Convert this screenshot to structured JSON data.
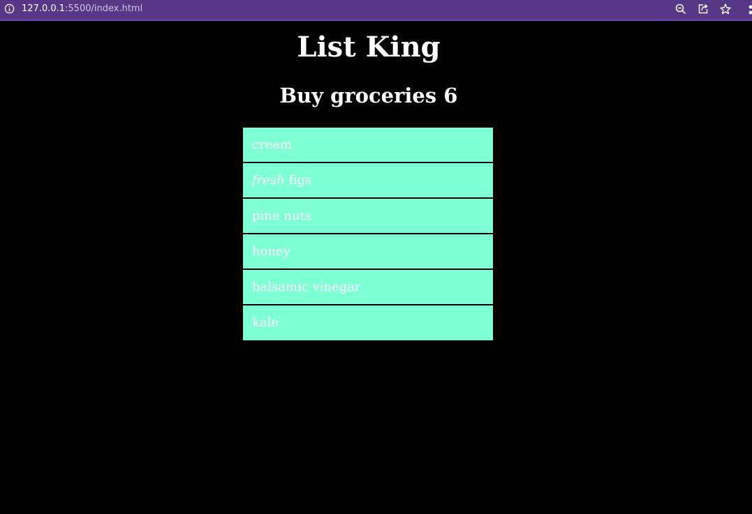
{
  "browser": {
    "url_host": "127.0.0.1",
    "url_rest": ":5500/index.html",
    "icons": [
      "site-info-icon",
      "zoom-out-icon",
      "share-icon",
      "star-icon",
      "extensions-menu-icon"
    ]
  },
  "page": {
    "site_title": "List King",
    "list_title": "Buy groceries 6",
    "items": [
      {
        "label": "cream"
      },
      {
        "emphasis": "fresh",
        "label": " figs"
      },
      {
        "label": "pine nuts"
      },
      {
        "label": "honey"
      },
      {
        "label": "balsamic vinegar"
      },
      {
        "label": "kale"
      }
    ]
  },
  "colors": {
    "browser_bar": "#583786",
    "page_background": "#000000",
    "item_background": "#7fffd4",
    "text": "#ffffff"
  }
}
